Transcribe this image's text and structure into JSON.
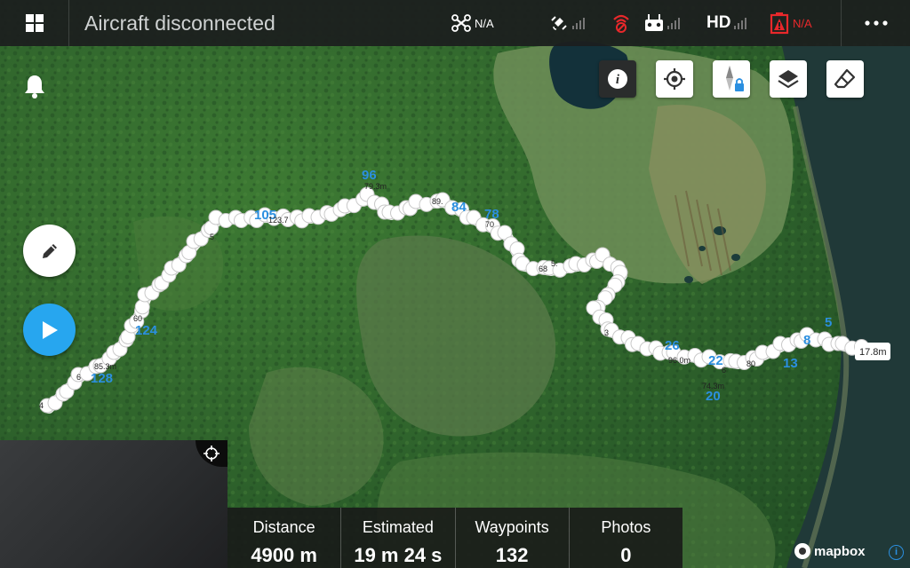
{
  "header": {
    "title": "Aircraft disconnected",
    "aircraft_status": "N/A",
    "video_label": "HD",
    "battery_status": "N/A",
    "icons": [
      "grid-menu-icon",
      "drone-icon",
      "satellite-icon",
      "rc-signal-icon",
      "controller-icon",
      "battery-warning-icon",
      "more-icon"
    ]
  },
  "map_tools": [
    "info-icon",
    "locate-icon",
    "compass-lock-icon",
    "layers-icon",
    "eraser-icon"
  ],
  "waypoint_labels": {
    "start": "17.8m",
    "numbers": [
      "96",
      "105",
      "84",
      "78",
      "124",
      "128",
      "26",
      "22",
      "20",
      "13",
      "5",
      "8"
    ],
    "altitudes": [
      "79.3m",
      "89.",
      "123.7",
      "85.3m",
      "96.0m",
      "74.3m",
      "80",
      "6",
      "4",
      "3",
      "5",
      "60",
      "70",
      "68",
      "5:",
      "6"
    ]
  },
  "stats": [
    {
      "label": "Distance",
      "value": "4900 m"
    },
    {
      "label": "Estimated",
      "value": "19 m 24 s"
    },
    {
      "label": "Waypoints",
      "value": "132"
    },
    {
      "label": "Photos",
      "value": "0"
    }
  ],
  "attribution": {
    "brand": "mapbox",
    "info": "i"
  },
  "colors": {
    "accent": "#27a6ef",
    "warning": "#e8282b",
    "bar": "#1c1e1e",
    "waypoint_number": "#2b8fe0"
  }
}
